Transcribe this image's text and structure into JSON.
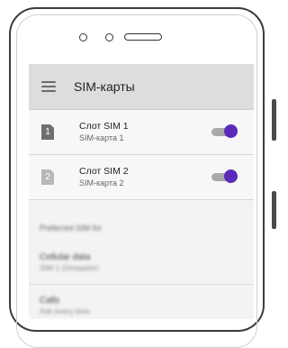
{
  "app_bar": {
    "title": "SIM-карты",
    "menu_icon": "hamburger-menu-icon"
  },
  "sim_slots": [
    {
      "number": "1",
      "title": "Слот SIM 1",
      "subtitle": "SIM-карта 1",
      "enabled": true,
      "badge_color": "#6f6f6f"
    },
    {
      "number": "2",
      "title": "Слот SIM 2",
      "subtitle": "SIM-карта 2",
      "enabled": true,
      "badge_color": "#b8b8b8"
    }
  ],
  "preferences": {
    "header": "Preferred SIM for",
    "items": [
      {
        "title": "Cellular data",
        "subtitle": "SIM 1 (Операtor)"
      },
      {
        "title": "Calls",
        "subtitle": "Ask every time"
      }
    ]
  },
  "colors": {
    "toggle_on": "#5b2ab8",
    "appbar_bg": "#dddddd",
    "screen_bg": "#f3f3f3"
  }
}
